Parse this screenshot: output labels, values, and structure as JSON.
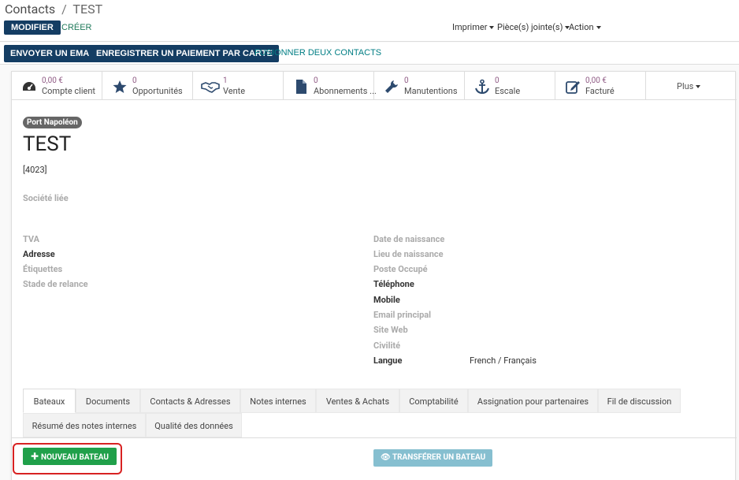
{
  "breadcrumb": {
    "parent": "Contacts",
    "separator": "/",
    "current": "TEST"
  },
  "toolbar": {
    "edit_label": "MODIFIER",
    "create_label": "CRÉER",
    "print_label": "Imprimer",
    "attachments_label": "Pièce(s) jointe(s)",
    "action_label": "Action"
  },
  "header_buttons": {
    "send_email": "ENVOYER UN EMAIL",
    "register_payment": "ENREGISTRER UN PAIEMENT PAR CARTE",
    "merge_contacts": "FUSIONNER DEUX CONTACTS"
  },
  "stat_buttons": [
    {
      "value": "0,00 €",
      "label": "Compte client",
      "icon": "dashboard-icon"
    },
    {
      "value": "0",
      "label": "Opportunités",
      "icon": "star-icon"
    },
    {
      "value": "1",
      "label": "Vente",
      "icon": "handshake-icon"
    },
    {
      "value": "0",
      "label": "Abonnements ...",
      "icon": "file-icon"
    },
    {
      "value": "0",
      "label": "Manutentions",
      "icon": "wrench-icon"
    },
    {
      "value": "0",
      "label": "Escale",
      "icon": "anchor-icon"
    },
    {
      "value": "0,00 €",
      "label": "Facturé",
      "icon": "edit-icon"
    }
  ],
  "more_label": "Plus",
  "record": {
    "tag": "Port Napoléon",
    "name": "TEST",
    "ref": "[4023]"
  },
  "fields_left": {
    "linked_company": "Société liée",
    "vat": "TVA",
    "address": "Adresse",
    "tags": "Étiquettes",
    "dunning_stage": "Stade de relance"
  },
  "fields_right": {
    "birth_date": "Date de naissance",
    "birth_place": "Lieu de naissance",
    "job_position": "Poste Occupé",
    "phone": "Téléphone",
    "mobile": "Mobile",
    "email": "Email principal",
    "website": "Site Web",
    "title": "Civilité",
    "language": "Langue",
    "language_value": "French / Français"
  },
  "tabs": [
    "Bateaux",
    "Documents",
    "Contacts & Adresses",
    "Notes internes",
    "Ventes & Achats",
    "Comptabilité",
    "Assignation pour partenaires",
    "Fil de discussion",
    "Résumé des notes internes",
    "Qualité des données"
  ],
  "tab_actions": {
    "new_boat": "NOUVEAU BATEAU",
    "transfer_boat": "TRANSFÉRER UN BATEAU"
  },
  "colors": {
    "primary": "#143d63",
    "teal": "#017e84",
    "stat_value": "#8f5a84",
    "green": "#20a04a",
    "highlight": "#d82222"
  }
}
